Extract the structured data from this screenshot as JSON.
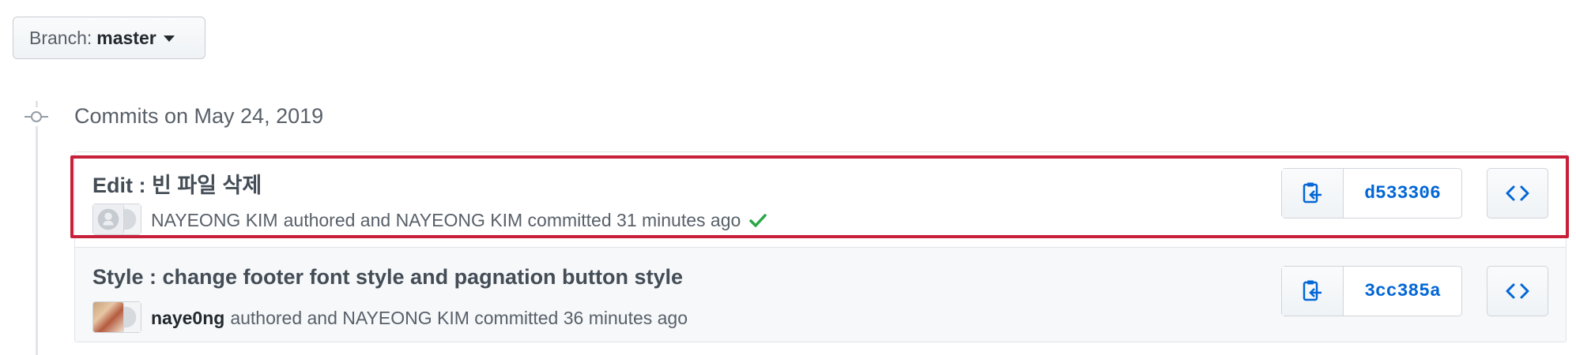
{
  "branch": {
    "label": "Branch:",
    "value": "master"
  },
  "group": {
    "title": "Commits on May 24, 2019"
  },
  "commits": [
    {
      "title": "Edit : 빈 파일 삭제",
      "author": "NAYEONG KIM",
      "meta": "authored and NAYEONG KIM committed 31 minutes ago",
      "sha": "d533306",
      "status": "success",
      "status_color": "#28a745"
    },
    {
      "title": "Style : change footer font style and pagnation button style",
      "author": "naye0ng",
      "meta": "authored and NAYEONG KIM committed 36 minutes ago",
      "sha": "3cc385a"
    }
  ],
  "icons": {
    "copy": "clippy-icon",
    "browse": "code-icon",
    "status": "check-icon",
    "node": "git-commit-icon"
  },
  "colors": {
    "link": "#0366d6",
    "highlight": "#c8203a"
  }
}
